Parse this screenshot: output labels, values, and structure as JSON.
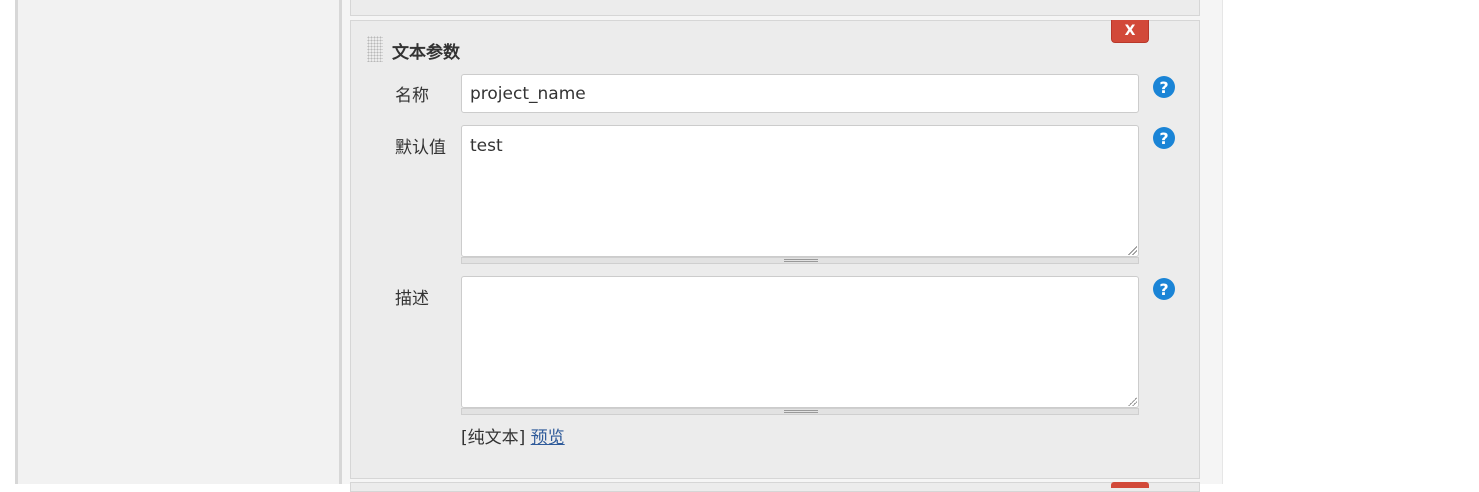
{
  "param_block": {
    "title": "文本参数",
    "delete_label": "X",
    "name": {
      "label": "名称",
      "value": "project_name"
    },
    "default_value": {
      "label": "默认值",
      "value": "test"
    },
    "description": {
      "label": "描述",
      "value": ""
    },
    "help_glyph": "?",
    "format": {
      "plain_text": "[纯文本]",
      "preview_link": "预览"
    }
  },
  "colors": {
    "delete_button": "#d24939",
    "help_icon": "#1a84d6",
    "link": "#2f5b9a",
    "block_background": "#ececec"
  },
  "icons": [
    "drag-handle-icon",
    "help-icon",
    "resize-grip-icon"
  ]
}
